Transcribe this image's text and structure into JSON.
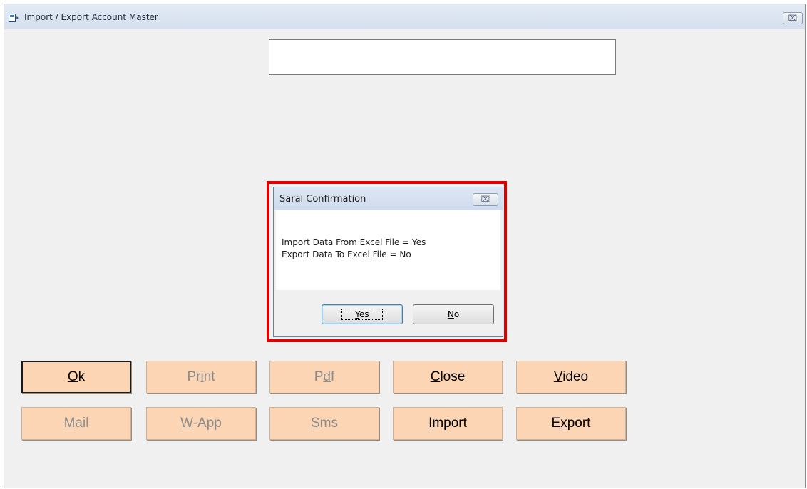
{
  "window": {
    "title": "Import / Export Account Master",
    "close_glyph": "⌧"
  },
  "main": {
    "text_value": ""
  },
  "dialog": {
    "title": "Saral Confirmation",
    "close_glyph": "⌧",
    "line1": "Import Data From Excel File = Yes",
    "line2": "Export Data To Excel File = No",
    "yes": {
      "pre": "",
      "ul": "Y",
      "post": "es"
    },
    "no": {
      "pre": "",
      "ul": "N",
      "post": "o"
    }
  },
  "buttons": {
    "ok": {
      "pre": "",
      "ul": "O",
      "post": "k"
    },
    "print": {
      "pre": "Pr",
      "ul": "i",
      "post": "nt"
    },
    "pdf": {
      "pre": "P",
      "ul": "d",
      "post": "f"
    },
    "close": {
      "pre": "",
      "ul": "C",
      "post": "lose"
    },
    "video": {
      "pre": "",
      "ul": "V",
      "post": "ideo"
    },
    "mail": {
      "pre": "",
      "ul": "M",
      "post": "ail"
    },
    "wapp": {
      "pre": "",
      "ul": "W",
      "post": "-App"
    },
    "sms": {
      "pre": "",
      "ul": "S",
      "post": "ms"
    },
    "import": {
      "pre": "",
      "ul": "I",
      "post": "mport"
    },
    "export": {
      "pre": "E",
      "ul": "x",
      "post": "port"
    }
  },
  "colors": {
    "button_bg": "#fcd5b4",
    "highlight": "#e00000",
    "disabled_text": "#8c8c8c"
  }
}
